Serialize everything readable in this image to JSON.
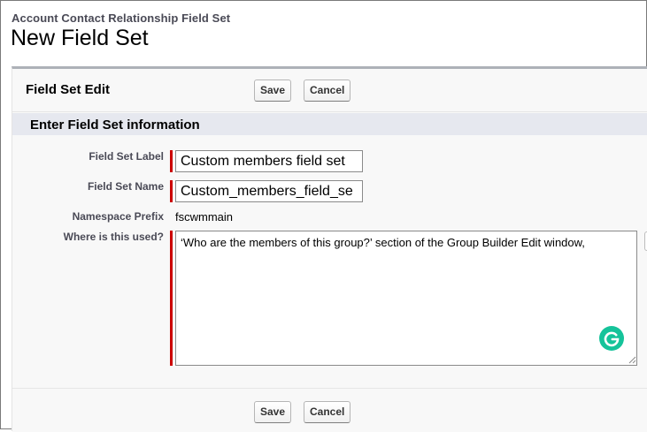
{
  "header": {
    "breadcrumb": "Account Contact Relationship Field Set",
    "title": "New Field Set"
  },
  "panel": {
    "title": "Field Set Edit",
    "save_label": "Save",
    "cancel_label": "Cancel"
  },
  "section": {
    "title": "Enter Field Set information"
  },
  "form": {
    "label_field_label": "Field Set Label",
    "label_field_value": "Custom members field set",
    "name_field_label": "Field Set Name",
    "name_field_value": "Custom_members_field_se",
    "namespace_label": "Namespace Prefix",
    "namespace_value": "fscwmmain",
    "where_used_label": "Where is this used?",
    "where_used_value": "‘Who are the members of this group?’ section of the Group Builder Edit window,"
  },
  "footer": {
    "save_label": "Save",
    "cancel_label": "Cancel"
  },
  "colors": {
    "required_bar": "#cc0000",
    "section_bg": "#e6e8ef",
    "grammarly": "#15c39a"
  },
  "icons": {
    "grammarly": "grammarly-icon",
    "resize": "resize-grip-icon"
  }
}
